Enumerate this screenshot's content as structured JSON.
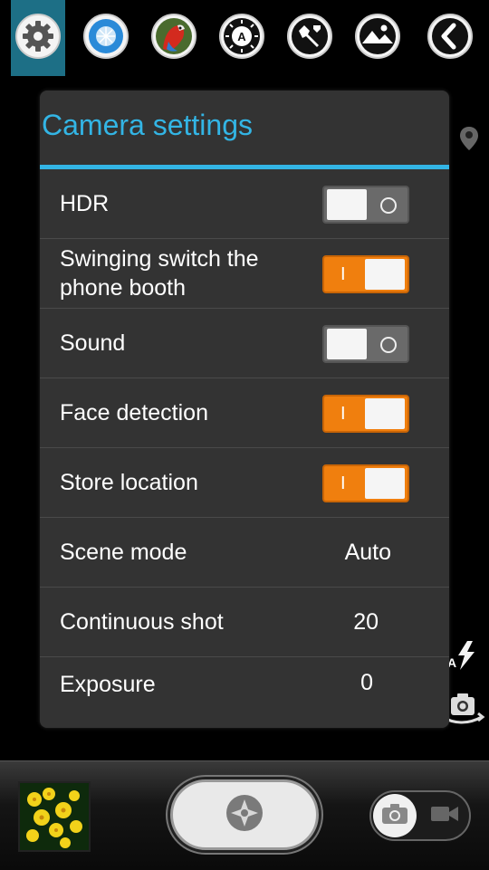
{
  "toolbar": {
    "icons": [
      "settings-gear-icon",
      "white-balance-icon",
      "color-effect-icon",
      "auto-mode-icon",
      "tools-icon",
      "landscape-icon",
      "back-icon"
    ]
  },
  "dialog": {
    "title": "Camera settings",
    "rows": [
      {
        "label": "HDR",
        "type": "toggle",
        "state": "off"
      },
      {
        "label": "Swinging switch the phone booth",
        "type": "toggle",
        "state": "on"
      },
      {
        "label": "Sound",
        "type": "toggle",
        "state": "off"
      },
      {
        "label": "Face detection",
        "type": "toggle",
        "state": "on"
      },
      {
        "label": "Store location",
        "type": "toggle",
        "state": "on"
      },
      {
        "label": "Scene mode",
        "type": "value",
        "value": "Auto"
      },
      {
        "label": "Continuous shot",
        "type": "value",
        "value": "20"
      },
      {
        "label": "Exposure",
        "type": "value",
        "value": "0"
      }
    ],
    "toggle_on_mark": "I"
  },
  "side": {
    "flash_label": "A"
  },
  "colors": {
    "accent": "#33b5e5",
    "toggle_on": "#f07f0e",
    "toggle_off": "#6a6a6a",
    "dialog_bg": "#333333"
  }
}
